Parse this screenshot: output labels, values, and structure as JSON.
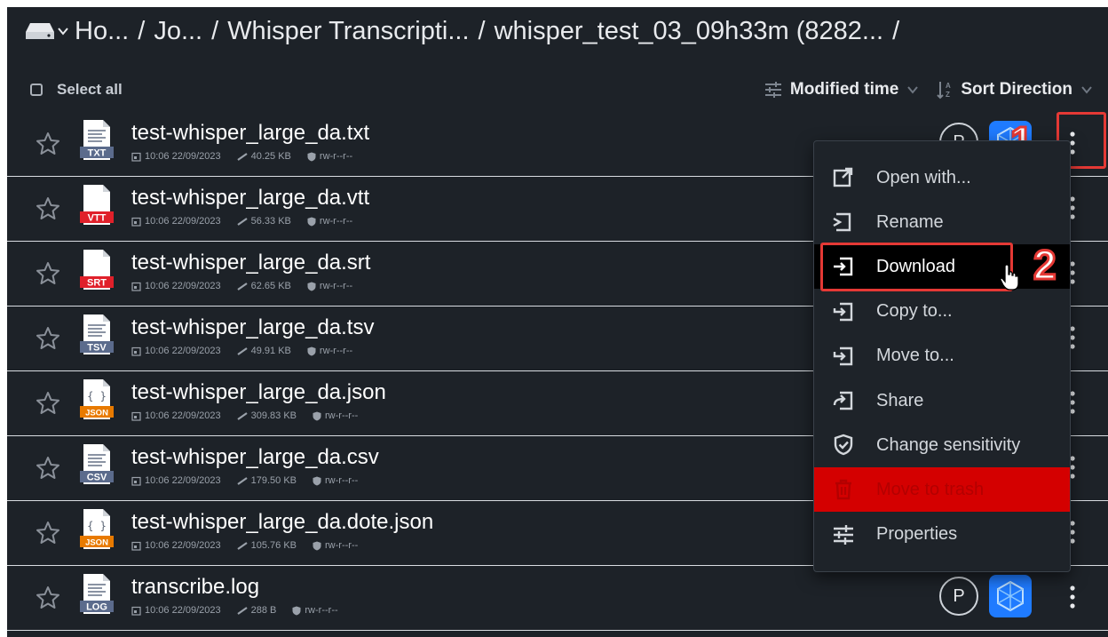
{
  "breadcrumb": {
    "items": [
      "Ho...",
      "Jo...",
      "Whisper Transcripti...",
      "whisper_test_03_09h33m (8282...",
      ""
    ],
    "separator": "/"
  },
  "toolbar": {
    "select_all": "Select all",
    "sort_field": "Modified time",
    "sort_direction": "Sort Direction"
  },
  "files": [
    {
      "name": "test-whisper_large_da.txt",
      "type": "TXT",
      "time": "10:06 22/09/2023",
      "size": "40.25 KB",
      "perms": "rw-r--r--",
      "badge_color": "#5b6b8c"
    },
    {
      "name": "test-whisper_large_da.vtt",
      "type": "VTT",
      "time": "10:06 22/09/2023",
      "size": "56.33 KB",
      "perms": "rw-r--r--",
      "badge_color": "#e0202a"
    },
    {
      "name": "test-whisper_large_da.srt",
      "type": "SRT",
      "time": "10:06 22/09/2023",
      "size": "62.65 KB",
      "perms": "rw-r--r--",
      "badge_color": "#e0202a"
    },
    {
      "name": "test-whisper_large_da.tsv",
      "type": "TSV",
      "time": "10:06 22/09/2023",
      "size": "49.91 KB",
      "perms": "rw-r--r--",
      "badge_color": "#5b6b8c"
    },
    {
      "name": "test-whisper_large_da.json",
      "type": "JSON",
      "time": "10:06 22/09/2023",
      "size": "309.83 KB",
      "perms": "rw-r--r--",
      "badge_color": "#e87a00"
    },
    {
      "name": "test-whisper_large_da.csv",
      "type": "CSV",
      "time": "10:06 22/09/2023",
      "size": "179.50 KB",
      "perms": "rw-r--r--",
      "badge_color": "#5b6b8c"
    },
    {
      "name": "test-whisper_large_da.dote.json",
      "type": "JSON",
      "time": "10:06 22/09/2023",
      "size": "105.76 KB",
      "perms": "rw-r--r--",
      "badge_color": "#e87a00"
    },
    {
      "name": "transcribe.log",
      "type": "LOG",
      "time": "10:06 22/09/2023",
      "size": "288 B",
      "perms": "rw-r--r--",
      "badge_color": "#5b6b8c"
    }
  ],
  "avatar_letter": "P",
  "context_menu": {
    "items": [
      {
        "label": "Open with...",
        "icon": "open-with-icon"
      },
      {
        "label": "Rename",
        "icon": "rename-icon"
      },
      {
        "label": "Download",
        "icon": "download-icon",
        "state": "hover"
      },
      {
        "label": "Copy to...",
        "icon": "copy-to-icon"
      },
      {
        "label": "Move to...",
        "icon": "move-to-icon"
      },
      {
        "label": "Share",
        "icon": "share-icon"
      },
      {
        "label": "Change sensitivity",
        "icon": "shield-check-icon"
      },
      {
        "label": "Move to trash",
        "icon": "trash-icon",
        "state": "danger"
      },
      {
        "label": "Properties",
        "icon": "properties-icon"
      }
    ]
  },
  "annotations": {
    "step1": "1",
    "step2": "2"
  },
  "colors": {
    "background": "#1d2228",
    "menu_hover": "#000000",
    "danger": "#d40000",
    "annotation_red": "#e53935",
    "app_icon_blue": "#1f7bff"
  }
}
